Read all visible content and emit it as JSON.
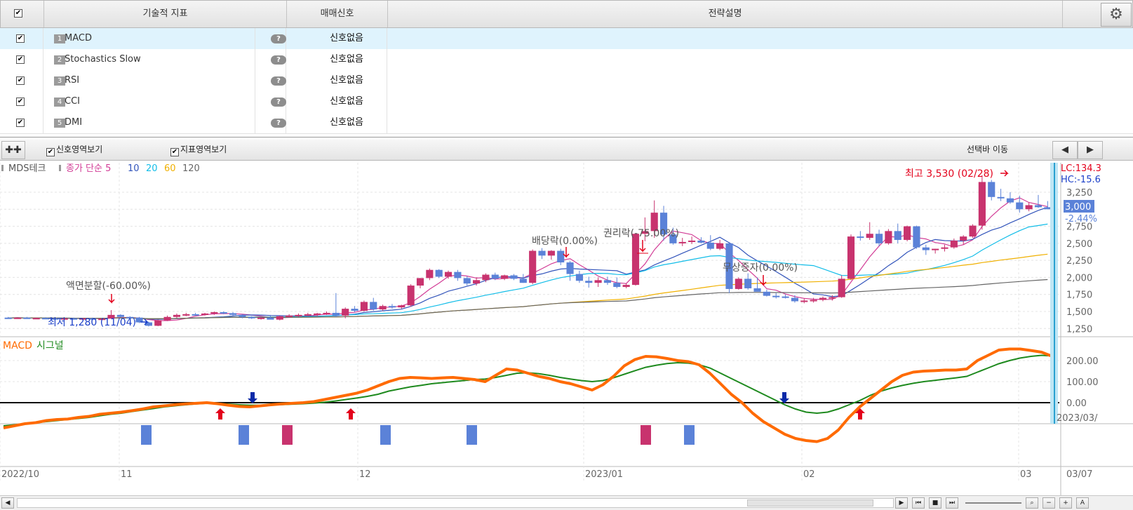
{
  "table": {
    "headers": {
      "indicator": "기술적 지표",
      "signal": "매매신호",
      "description": "전략설명"
    },
    "rows": [
      {
        "num": "1",
        "name": "MACD",
        "signal": "신호없음",
        "checked": true,
        "selected": true
      },
      {
        "num": "2",
        "name": "Stochastics Slow",
        "signal": "신호없음",
        "checked": true,
        "selected": false
      },
      {
        "num": "3",
        "name": "RSI",
        "signal": "신호없음",
        "checked": true,
        "selected": false
      },
      {
        "num": "4",
        "name": "CCI",
        "signal": "신호없음",
        "checked": true,
        "selected": false
      },
      {
        "num": "5",
        "name": "DMI",
        "signal": "신호없음",
        "checked": true,
        "selected": false
      }
    ]
  },
  "toolbar": {
    "show_signal_area": "신호영역보기",
    "show_indicator_area": "지표영역보기",
    "move_select_bar": "선택바 이동"
  },
  "price_legend": {
    "stock": "MDS테크",
    "ma_label": "종가 단순",
    "periods": [
      "5",
      "10",
      "20",
      "60",
      "120"
    ],
    "period_colors": [
      "#d23c96",
      "#3355bb",
      "#12bde8",
      "#f0b000",
      "#666666"
    ]
  },
  "annotations": {
    "split": "액면분할(-60.00%)",
    "dividend": "배당락(0.00%)",
    "rights": "권리락(-75.00%)",
    "bonus": "무상증자(0.00%)",
    "high": "최고 3,530 (02/28)",
    "low": "최저 1,280 (11/04)"
  },
  "right_axis": {
    "lc": "LC:134.3",
    "hc": "HC:-15.6",
    "current_price": "3,000",
    "change_pct": "-2.44%",
    "price_ticks": [
      "3,250",
      "2,750",
      "2,500",
      "2,250",
      "2,000",
      "1,750",
      "1,500",
      "1,250"
    ],
    "macd_ticks": [
      "200.00",
      "100.00",
      "0.00"
    ],
    "date_label": "2023/03/"
  },
  "macd_legend": {
    "macd": "MACD",
    "signal": "시그널"
  },
  "x_axis": {
    "labels": [
      "2022/10",
      "11",
      "12",
      "2023/01",
      "02",
      "03"
    ],
    "last": "03/07"
  },
  "colors": {
    "up": "#c8336e",
    "down": "#5b82d8",
    "macd": "#ff6a00",
    "signal": "#1e8a1e",
    "ma5": "#d23c96",
    "ma10": "#3355bb",
    "ma20": "#12bde8",
    "ma60": "#f0b000",
    "ma120": "#666666",
    "buy_arrow": "#e3001b",
    "sell_arrow": "#0a2aa8"
  },
  "chart_data": {
    "type": "candlestick",
    "ylim": [
      1150,
      3600
    ],
    "candles": [
      [
        1410,
        1420,
        1395,
        1405
      ],
      [
        1405,
        1415,
        1395,
        1410
      ],
      [
        1410,
        1420,
        1400,
        1400
      ],
      [
        1400,
        1410,
        1390,
        1405
      ],
      [
        1405,
        1415,
        1395,
        1400
      ],
      [
        1400,
        1410,
        1390,
        1395
      ],
      [
        1395,
        1400,
        1380,
        1400
      ],
      [
        1400,
        1410,
        1390,
        1395
      ],
      [
        1395,
        1405,
        1385,
        1400
      ],
      [
        1400,
        1410,
        1380,
        1390
      ],
      [
        1390,
        1400,
        1370,
        1395
      ],
      [
        1395,
        1520,
        1440,
        1450
      ],
      [
        1450,
        1460,
        1410,
        1420
      ],
      [
        1420,
        1430,
        1400,
        1410
      ],
      [
        1410,
        1420,
        1330,
        1340
      ],
      [
        1340,
        1350,
        1280,
        1290
      ],
      [
        1290,
        1380,
        1285,
        1370
      ],
      [
        1370,
        1440,
        1360,
        1420
      ],
      [
        1420,
        1470,
        1400,
        1450
      ],
      [
        1450,
        1480,
        1430,
        1460
      ],
      [
        1460,
        1480,
        1440,
        1455
      ],
      [
        1455,
        1480,
        1440,
        1470
      ],
      [
        1470,
        1500,
        1450,
        1490
      ],
      [
        1490,
        1500,
        1460,
        1475
      ],
      [
        1475,
        1490,
        1440,
        1450
      ],
      [
        1450,
        1460,
        1400,
        1420
      ],
      [
        1420,
        1430,
        1390,
        1400
      ],
      [
        1400,
        1420,
        1380,
        1410
      ],
      [
        1410,
        1450,
        1390,
        1380
      ],
      [
        1380,
        1440,
        1370,
        1430
      ],
      [
        1430,
        1460,
        1410,
        1440
      ],
      [
        1440,
        1470,
        1420,
        1450
      ],
      [
        1450,
        1480,
        1430,
        1460
      ],
      [
        1460,
        1480,
        1430,
        1470
      ],
      [
        1470,
        1500,
        1450,
        1480
      ],
      [
        1480,
        1770,
        1420,
        1440
      ],
      [
        1440,
        1560,
        1400,
        1540
      ],
      [
        1540,
        1580,
        1490,
        1510
      ],
      [
        1510,
        1660,
        1500,
        1640
      ],
      [
        1640,
        1700,
        1510,
        1530
      ],
      [
        1530,
        1600,
        1510,
        1580
      ],
      [
        1580,
        1610,
        1540,
        1560
      ],
      [
        1560,
        1600,
        1540,
        1590
      ],
      [
        1590,
        1900,
        1570,
        1880
      ],
      [
        1880,
        1990,
        1840,
        1990
      ],
      [
        1990,
        2130,
        1960,
        2110
      ],
      [
        2110,
        2120,
        1990,
        2010
      ],
      [
        2010,
        2100,
        1980,
        2080
      ],
      [
        2080,
        2110,
        1950,
        1990
      ],
      [
        1990,
        2020,
        1880,
        1910
      ],
      [
        1910,
        2000,
        1880,
        1960
      ],
      [
        1960,
        2060,
        1930,
        2040
      ],
      [
        2040,
        2070,
        1960,
        1980
      ],
      [
        1980,
        2040,
        1960,
        2030
      ],
      [
        2030,
        2050,
        1960,
        1980
      ],
      [
        1980,
        2050,
        1920,
        1920
      ],
      [
        1920,
        2410,
        1900,
        2390
      ],
      [
        2390,
        2430,
        2270,
        2320
      ],
      [
        2320,
        2400,
        2260,
        2390
      ],
      [
        2390,
        2420,
        2180,
        2220
      ],
      [
        2220,
        2240,
        1950,
        2050
      ],
      [
        2050,
        2100,
        1920,
        1950
      ],
      [
        1950,
        2010,
        1850,
        1920
      ],
      [
        1920,
        2000,
        1860,
        1960
      ],
      [
        1960,
        2010,
        1890,
        1920
      ],
      [
        1920,
        2000,
        1840,
        1860
      ],
      [
        1860,
        1910,
        1840,
        1890
      ],
      [
        1890,
        2650,
        1880,
        2640
      ],
      [
        2640,
        2880,
        2530,
        2680
      ],
      [
        2680,
        3130,
        2580,
        2950
      ],
      [
        2950,
        3050,
        2540,
        2630
      ],
      [
        2630,
        2730,
        2480,
        2500
      ],
      [
        2500,
        2580,
        2460,
        2520
      ],
      [
        2520,
        2600,
        2490,
        2540
      ],
      [
        2540,
        2590,
        2500,
        2510
      ],
      [
        2510,
        2620,
        2400,
        2420
      ],
      [
        2420,
        2550,
        2400,
        2500
      ],
      [
        2500,
        2520,
        1770,
        1830
      ],
      [
        1830,
        2000,
        1820,
        1980
      ],
      [
        1980,
        2060,
        1820,
        1840
      ],
      [
        1840,
        2000,
        1800,
        1790
      ],
      [
        1790,
        1820,
        1720,
        1730
      ],
      [
        1730,
        1770,
        1690,
        1720
      ],
      [
        1720,
        1750,
        1690,
        1700
      ],
      [
        1700,
        1740,
        1630,
        1650
      ],
      [
        1650,
        1690,
        1620,
        1660
      ],
      [
        1660,
        1700,
        1630,
        1670
      ],
      [
        1670,
        1720,
        1650,
        1700
      ],
      [
        1700,
        1740,
        1660,
        1710
      ],
      [
        1710,
        2030,
        1700,
        1980
      ],
      [
        1980,
        2630,
        1960,
        2600
      ],
      [
        2600,
        2680,
        2540,
        2580
      ],
      [
        2580,
        2810,
        2550,
        2640
      ],
      [
        2640,
        2700,
        2460,
        2500
      ],
      [
        2500,
        2710,
        2480,
        2680
      ],
      [
        2680,
        2790,
        2500,
        2550
      ],
      [
        2550,
        2760,
        2530,
        2750
      ],
      [
        2750,
        2760,
        2420,
        2440
      ],
      [
        2440,
        2480,
        2330,
        2400
      ],
      [
        2400,
        2420,
        2350,
        2420
      ],
      [
        2420,
        2480,
        2380,
        2440
      ],
      [
        2440,
        2570,
        2420,
        2540
      ],
      [
        2540,
        2620,
        2480,
        2600
      ],
      [
        2600,
        2780,
        2580,
        2760
      ],
      [
        2760,
        3500,
        2700,
        3400
      ],
      [
        3400,
        3430,
        3130,
        3180
      ],
      [
        3180,
        3300,
        3120,
        3160
      ],
      [
        3160,
        3250,
        3080,
        3100
      ],
      [
        3100,
        3200,
        2950,
        3000
      ],
      [
        3000,
        3100,
        2970,
        3060
      ],
      [
        3060,
        3210,
        3020,
        3030
      ],
      [
        3030,
        3120,
        3000,
        3000
      ]
    ],
    "macd": [
      -120,
      -110,
      -100,
      -95,
      -85,
      -80,
      -78,
      -70,
      -65,
      -55,
      -50,
      -45,
      -38,
      -30,
      -20,
      -15,
      -10,
      -6,
      -3,
      0,
      -5,
      -12,
      -18,
      -20,
      -15,
      -10,
      -6,
      -3,
      0,
      5,
      15,
      25,
      35,
      45,
      60,
      80,
      100,
      115,
      120,
      118,
      115,
      118,
      120,
      115,
      110,
      100,
      130,
      160,
      155,
      140,
      125,
      115,
      100,
      90,
      75,
      60,
      85,
      125,
      175,
      205,
      220,
      218,
      210,
      200,
      195,
      180,
      140,
      90,
      40,
      0,
      -50,
      -90,
      -120,
      -150,
      -170,
      -180,
      -185,
      -170,
      -130,
      -70,
      -20,
      20,
      60,
      100,
      130,
      145,
      150,
      152,
      155,
      155,
      160,
      200,
      225,
      250,
      255,
      255,
      248,
      240,
      220
    ],
    "signal": [
      -110,
      -105,
      -100,
      -95,
      -90,
      -85,
      -80,
      -75,
      -70,
      -62,
      -55,
      -50,
      -42,
      -35,
      -28,
      -20,
      -15,
      -10,
      -6,
      -3,
      -4,
      -7,
      -10,
      -12,
      -12,
      -11,
      -9,
      -7,
      -5,
      -2,
      2,
      8,
      15,
      22,
      30,
      40,
      55,
      65,
      75,
      82,
      90,
      95,
      100,
      105,
      110,
      112,
      120,
      130,
      140,
      142,
      138,
      130,
      120,
      112,
      105,
      100,
      105,
      118,
      135,
      152,
      168,
      178,
      186,
      190,
      188,
      180,
      165,
      140,
      115,
      90,
      65,
      40,
      15,
      -10,
      -30,
      -45,
      -50,
      -45,
      -30,
      -10,
      10,
      35,
      55,
      70,
      82,
      92,
      100,
      106,
      112,
      118,
      125,
      145,
      165,
      185,
      200,
      212,
      220,
      225,
      222
    ]
  }
}
